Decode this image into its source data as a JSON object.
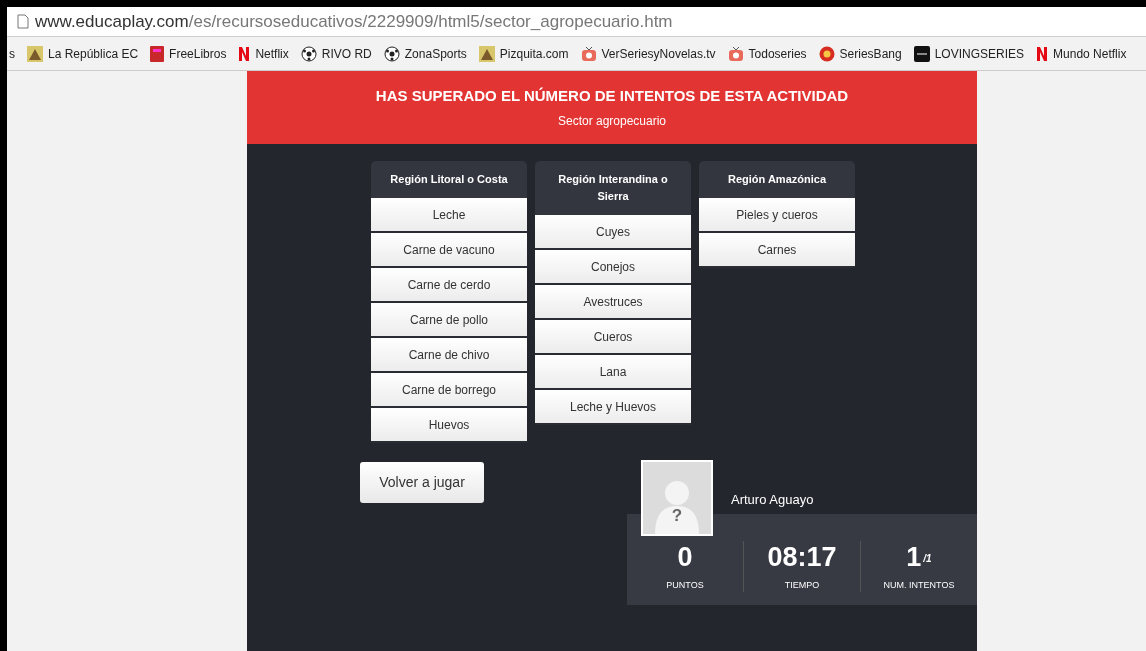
{
  "address_bar": {
    "host": "www.educaplay.com",
    "path": "/es/recursoseducativos/2229909/html5/sector_agropecuario.htm"
  },
  "bookmarks": [
    {
      "label": "s",
      "kind": "none"
    },
    {
      "label": "La República EC",
      "kind": "picture"
    },
    {
      "label": "FreeLibros",
      "kind": "book"
    },
    {
      "label": "Netflix",
      "kind": "letter-n"
    },
    {
      "label": "RIVO RD",
      "kind": "ball"
    },
    {
      "label": "ZonaSports",
      "kind": "ball"
    },
    {
      "label": "Pizquita.com",
      "kind": "picture"
    },
    {
      "label": "VerSeriesyNovelas.tv",
      "kind": "tv"
    },
    {
      "label": "Todoseries",
      "kind": "tv"
    },
    {
      "label": "SeriesBang",
      "kind": "circle"
    },
    {
      "label": "LOVINGSERIES",
      "kind": "square"
    },
    {
      "label": "Mundo Netflix",
      "kind": "letter-n"
    }
  ],
  "banner": {
    "title": "HAS SUPERADO EL NÚMERO DE INTENTOS DE ESTA ACTIVIDAD",
    "subtitle": "Sector agropecuario"
  },
  "columns": [
    {
      "heading": "Región Litoral o Costa",
      "items": [
        "Leche",
        "Carne de vacuno",
        "Carne de cerdo",
        "Carne de pollo",
        "Carne de chivo",
        "Carne de borrego",
        "Huevos"
      ]
    },
    {
      "heading": "Región Interandina o Sierra",
      "items": [
        "Cuyes",
        "Conejos",
        "Avestruces",
        "Cueros",
        "Lana",
        "Leche y Huevos"
      ]
    },
    {
      "heading": "Región Amazónica",
      "items": [
        "Pieles y cueros",
        "Carnes"
      ]
    }
  ],
  "replay_button": "Volver a jugar",
  "player": {
    "name": "Arturo Aguayo",
    "avatar_mark": "?"
  },
  "stats": [
    {
      "value": "0",
      "label": "PUNTOS"
    },
    {
      "value": "08:17",
      "label": "TIEMPO"
    },
    {
      "value": "1",
      "suffix": "/1",
      "label": "NUM. INTENTOS"
    }
  ]
}
